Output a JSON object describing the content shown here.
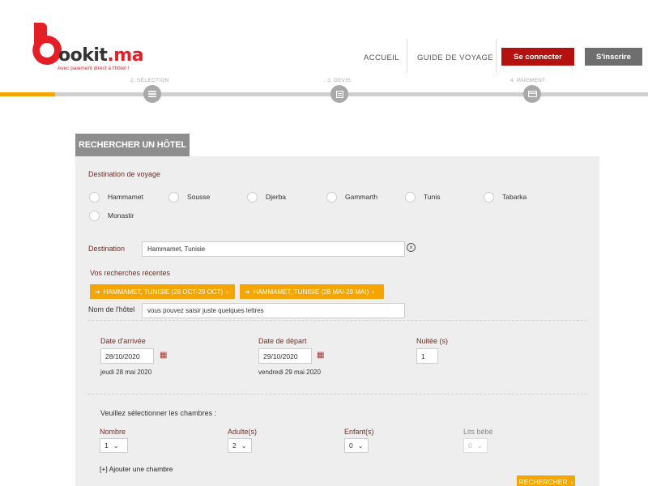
{
  "header": {
    "logo_text": "ookit",
    "logo_tld": ".ma",
    "logo_tagline": "Avec paiement direct à l'hôtel !",
    "nav": {
      "home": "ACCUEIL",
      "guide": "GUIDE DE VOYAGE"
    },
    "login_label": "Se connecter",
    "signup_label": "S'inscrire"
  },
  "steps": [
    {
      "label": "2. SÉLECTION",
      "icon": "list-icon"
    },
    {
      "label": "3. DEVIS",
      "icon": "document-icon"
    },
    {
      "label": "4. PAIEMENT",
      "icon": "card-icon"
    }
  ],
  "search": {
    "tab_title": "RECHERCHER UN HÔTEL",
    "destination_group_label": "Destination de voyage",
    "destinations": [
      "Hammamet",
      "Sousse",
      "Djerba",
      "Gammarth",
      "Tunis",
      "Tabarka",
      "Monastir"
    ],
    "destination_label": "Destination",
    "destination_value": "Hammamet, Tunisie",
    "recent_label": "Vos recherches récentes",
    "recent": [
      "HAMMAMET, TUNISIE (28 OCT-29 OCT)",
      "HAMMAMET, TUNISIE (28 MAI-29 MAI)"
    ],
    "hotel_label": "Nom de l'hôtel",
    "hotel_placeholder": "vous pouvez saisir juste quelques lettres",
    "arrival_label": "Date d'arrivée",
    "arrival_value": "28/10/2020",
    "arrival_day": "jeudi 28 mai 2020",
    "departure_label": "Date de départ",
    "departure_value": "29/10/2020",
    "departure_day": "vendredi 29 mai 2020",
    "nights_label": "Nuitée (s)",
    "nights_value": "1",
    "rooms_label": "Veuillez sélectionner les chambres :",
    "count_label": "Nombre",
    "count_value": "1",
    "adults_label": "Adulte(s)",
    "adults_value": "2",
    "children_label": "Enfant(s)",
    "children_value": "0",
    "cribs_label": "Lits bébé",
    "cribs_value": "0",
    "add_room_label": "[+] Ajouter une chambre",
    "submit_label": "RECHERCHER"
  },
  "colors": {
    "brand_red": "#e31e24",
    "login_red": "#b3120f",
    "accent_orange": "#f5a400",
    "label_maroon": "#7b2a22"
  }
}
